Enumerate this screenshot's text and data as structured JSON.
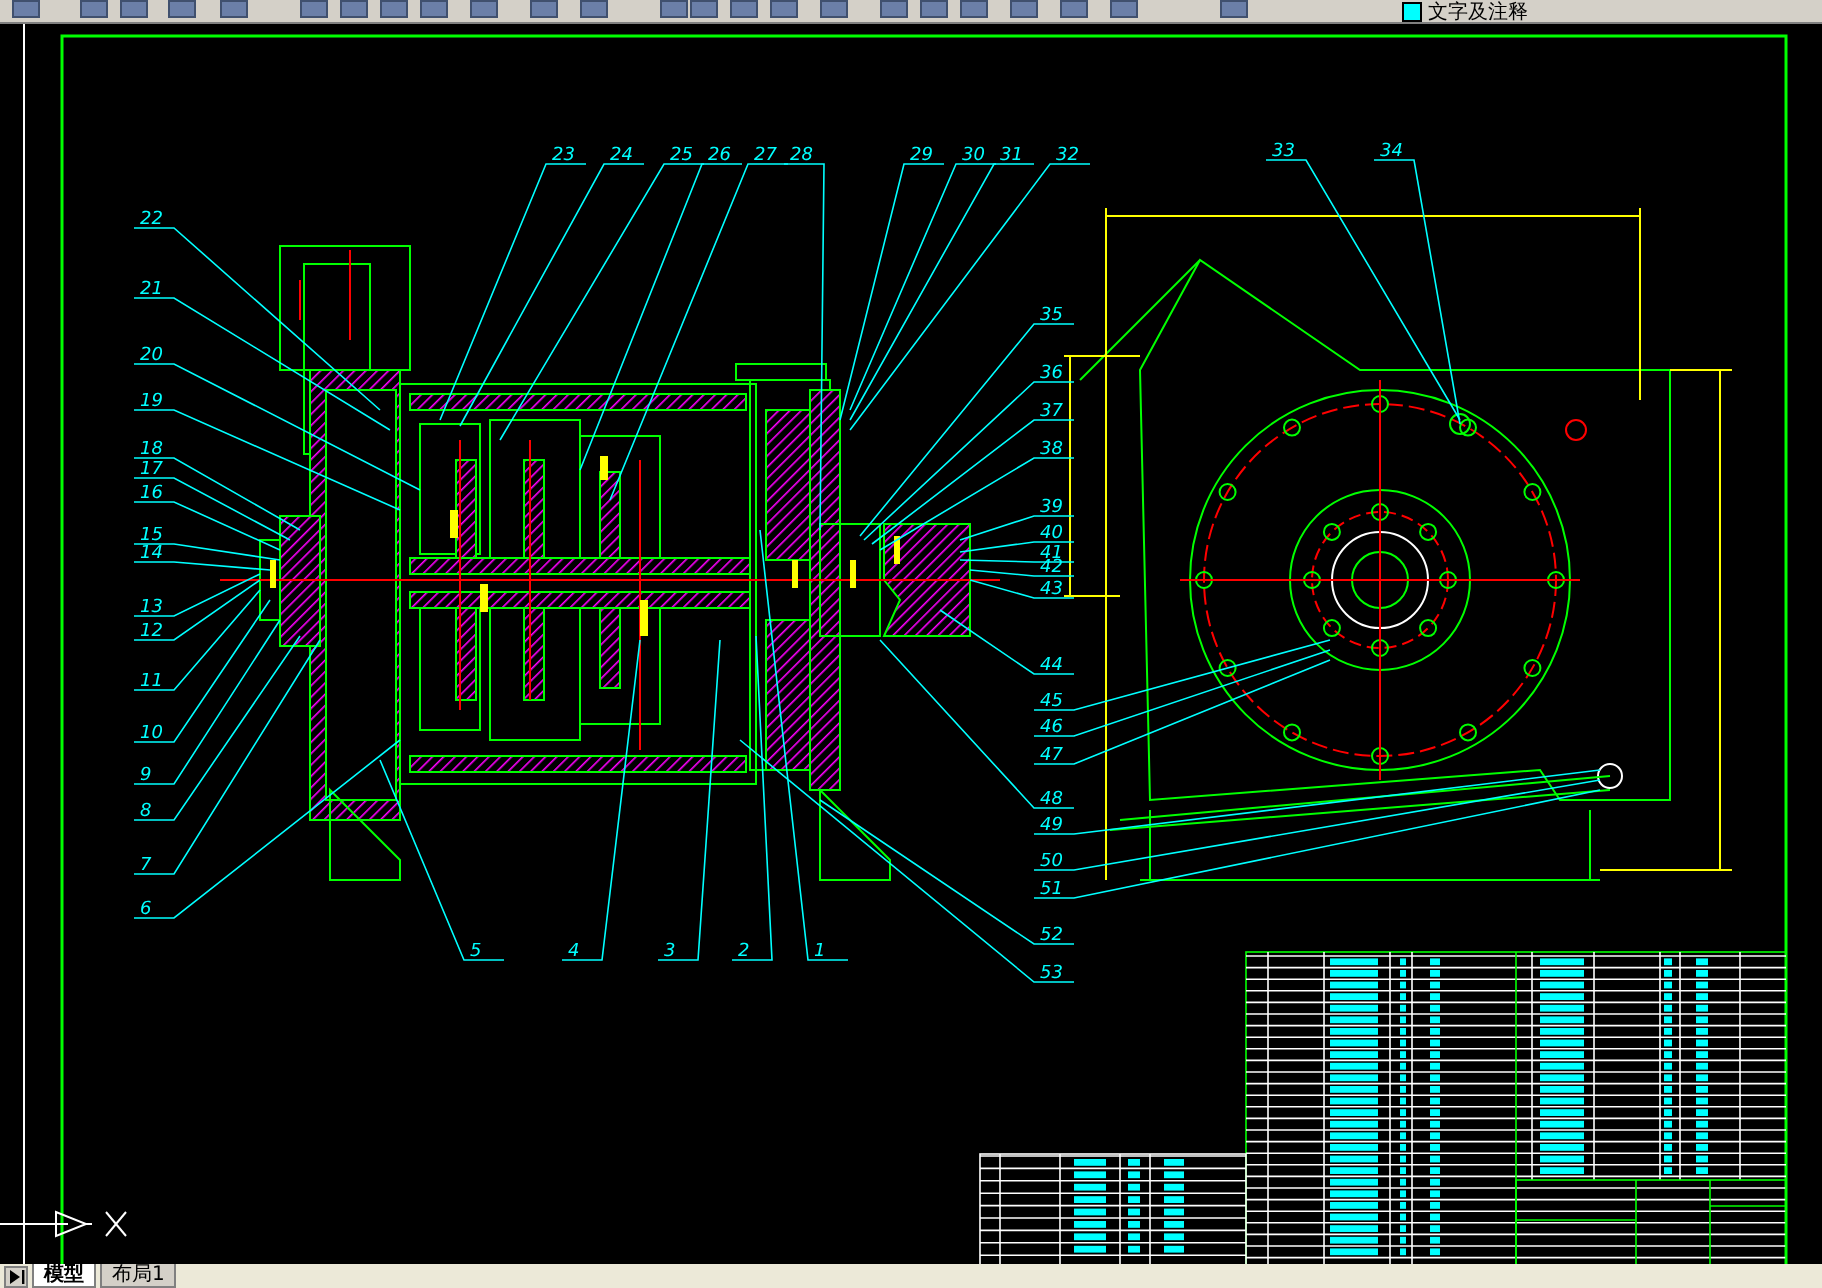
{
  "toolbar": {
    "layer_name": "文字及注释"
  },
  "drawing": {
    "part_numbers": [
      "23",
      "24",
      "25",
      "26",
      "27",
      "28",
      "29",
      "30",
      "31",
      "32",
      "33",
      "34",
      "22",
      "21",
      "20",
      "19",
      "18",
      "17",
      "16",
      "15",
      "14",
      "13",
      "12",
      "11",
      "10",
      "9",
      "8",
      "7",
      "6",
      "35",
      "36",
      "37",
      "38",
      "39",
      "40",
      "41",
      "42",
      "43",
      "44",
      "45",
      "46",
      "47",
      "48",
      "49",
      "50",
      "51",
      "52",
      "53",
      "5",
      "4",
      "3",
      "2",
      "1"
    ]
  },
  "layout_tabs": [
    {
      "label": "模型",
      "selected": true
    },
    {
      "label": "布局1",
      "selected": false
    }
  ]
}
